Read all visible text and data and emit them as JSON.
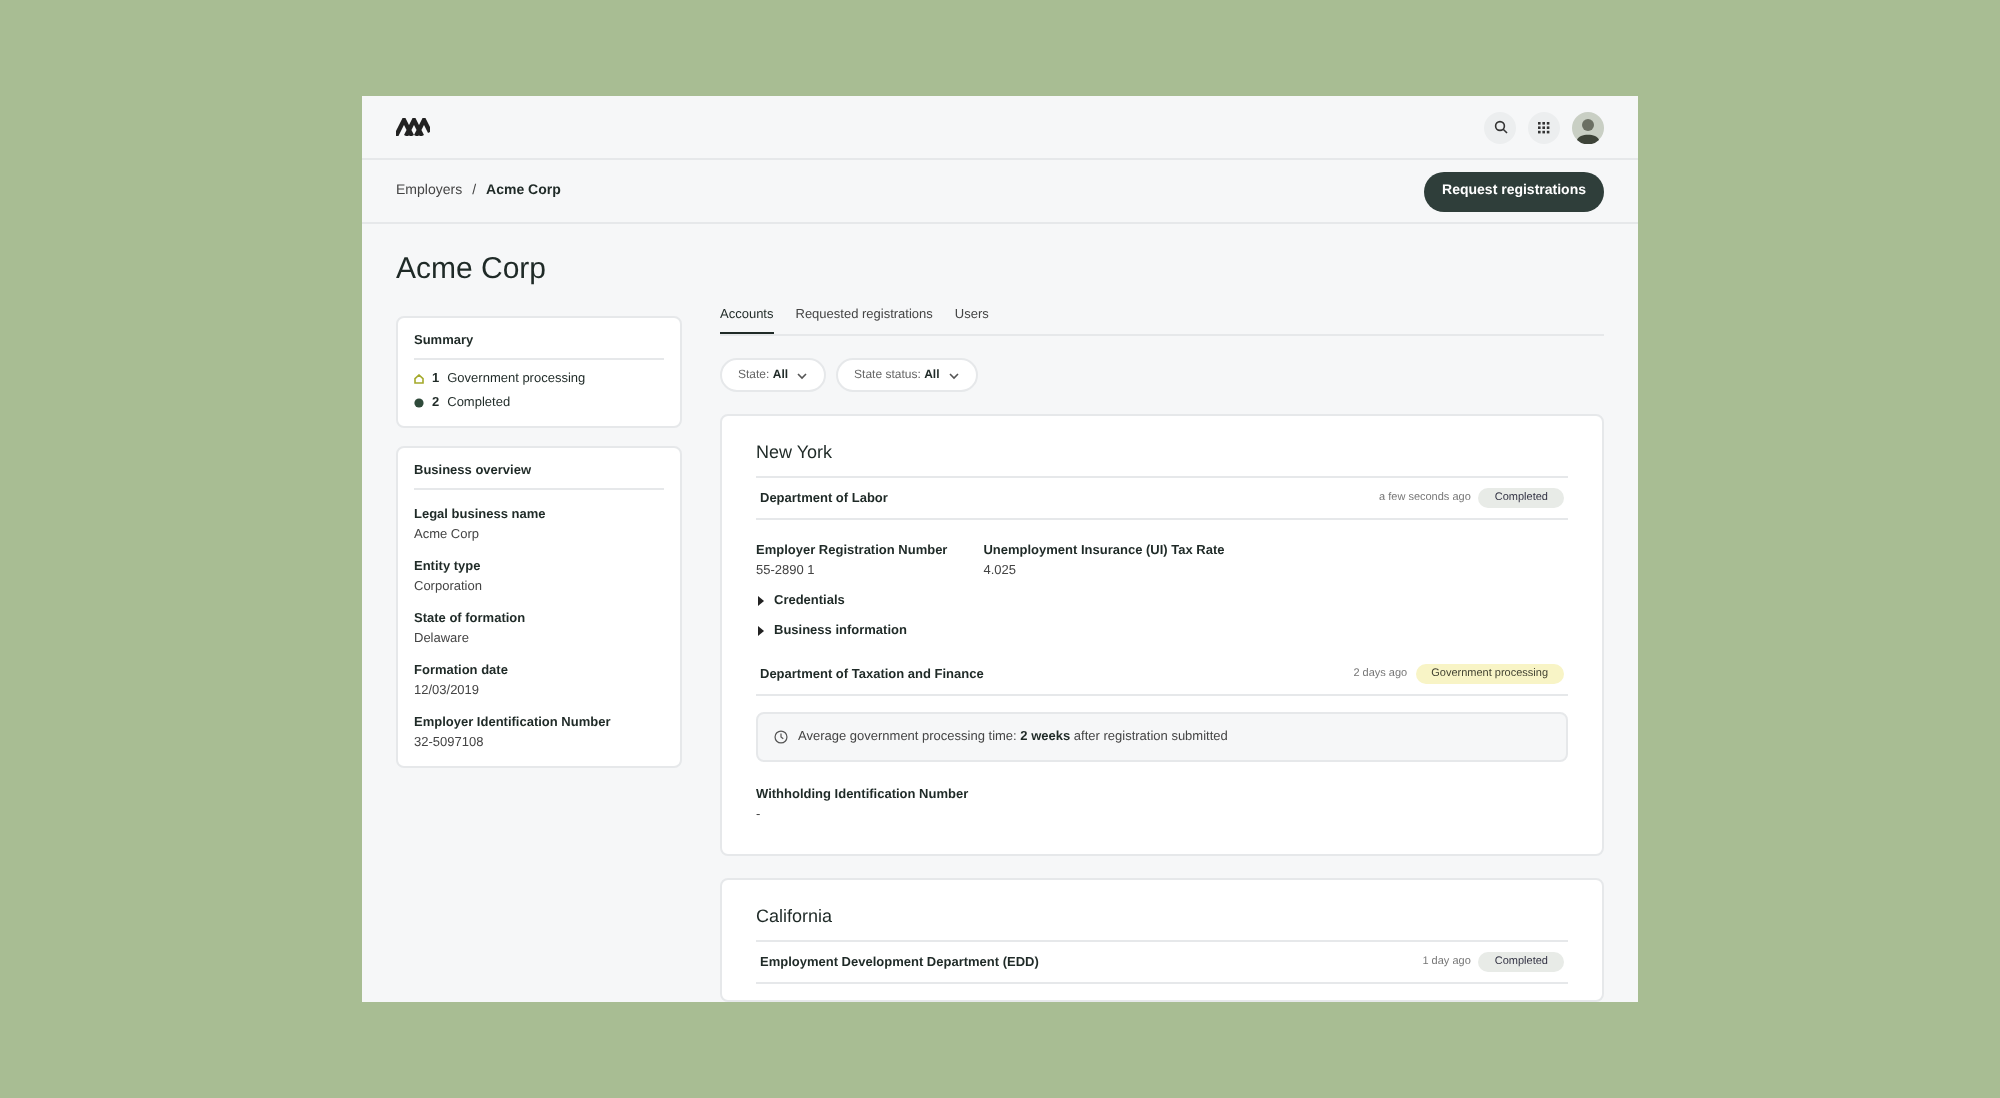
{
  "breadcrumb": [
    "Employers",
    "Acme Corp"
  ],
  "breadcrumb_separator": "/",
  "action": "Request registrations",
  "title": "Acme Corp",
  "summary": {
    "title": "Summary",
    "items": [
      {
        "count": "1",
        "label": "Government processing",
        "kind": "processing"
      },
      {
        "count": "2",
        "label": "Completed",
        "kind": "completed"
      }
    ]
  },
  "overview": {
    "title": "Business overview",
    "fields": [
      {
        "label": "Legal business name",
        "value": "Acme Corp"
      },
      {
        "label": "Entity type",
        "value": "Corporation"
      },
      {
        "label": "State of formation",
        "value": "Delaware"
      },
      {
        "label": "Formation date",
        "value": "12/03/2019"
      },
      {
        "label": "Employer Identification Number",
        "value": "32-5097108"
      }
    ]
  },
  "tabs": [
    {
      "label": "Accounts",
      "selected": true
    },
    {
      "label": "Requested registrations",
      "selected": false
    },
    {
      "label": "Users",
      "selected": false
    }
  ],
  "filters": [
    {
      "label": "State:",
      "value": "All"
    },
    {
      "label": "State status:",
      "value": "All"
    }
  ],
  "states": [
    {
      "name": "New York",
      "departments": [
        {
          "name": "Department of Labor",
          "time": "a few seconds ago",
          "status": {
            "label": "Completed",
            "kind": "completed"
          },
          "fields": [
            {
              "label": "Employer Registration Number",
              "value": "55-2890 1"
            },
            {
              "label": "Unemployment Insurance (UI) Tax Rate",
              "value": "4.025"
            }
          ],
          "expanders": [
            {
              "label": "Credentials",
              "expanded": false
            },
            {
              "label": "Business information",
              "expanded": false
            }
          ]
        },
        {
          "name": "Department of Taxation and Finance",
          "time": "2 days ago",
          "status": {
            "label": "Government processing",
            "kind": "processing"
          },
          "notice": "Average government processing time: **2 weeks** after registration submitted",
          "fields": [
            {
              "label": "Withholding Identification Number",
              "value": "-"
            }
          ]
        }
      ]
    },
    {
      "name": "California",
      "departments": [
        {
          "name": "Employment Development Department (EDD)",
          "time": "1 day ago",
          "status": {
            "label": "Completed",
            "kind": "completed"
          }
        }
      ]
    }
  ]
}
